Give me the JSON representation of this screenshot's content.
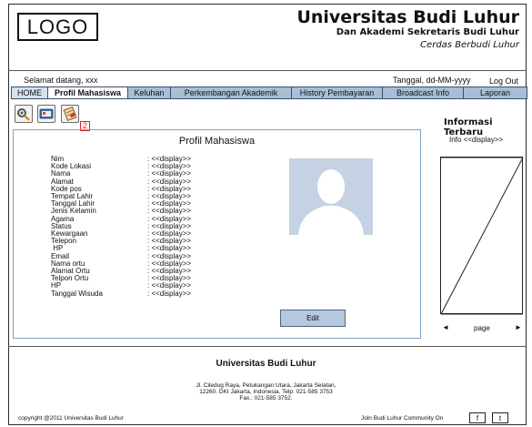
{
  "header": {
    "logo_text": "LOGO",
    "title": "Universitas Budi Luhur",
    "subtitle": "Dan Akademi Sekretaris Budi Luhur",
    "tagline": "Cerdas Berbudi Luhur"
  },
  "userbar": {
    "welcome": "Selamat datang, xxx",
    "date": "Tanggal, dd-MM-yyyy",
    "logout": "Log Out"
  },
  "nav": {
    "items": [
      {
        "label": "HOME"
      },
      {
        "label": "Profil Mahasiswa"
      },
      {
        "label": "Keluhan"
      },
      {
        "label": "Perkembangan Akademik"
      },
      {
        "label": "History Pembayaran"
      },
      {
        "label": "Broadcast Info"
      },
      {
        "label": "Laporan"
      }
    ]
  },
  "toolbar": {
    "icons": [
      "settings-icon",
      "card-icon",
      "notes-icon"
    ],
    "badge": "2"
  },
  "profile": {
    "title": "Profil Mahasiswa",
    "fields": [
      {
        "label": "Nim",
        "value": ": <<display>>"
      },
      {
        "label": "Kode Lokasi",
        "value": ": <<display>>"
      },
      {
        "label": "Nama",
        "value": ": <<display>>"
      },
      {
        "label": "Alamat",
        "value": ": <<display>>"
      },
      {
        "label": "Kode pos",
        "value": ": <<display>>"
      },
      {
        "label": "Tempat Lahir",
        "value": ": <<display>>"
      },
      {
        "label": "Tanggal Lahir",
        "value": ": <<display>>"
      },
      {
        "label": "Jenis Kelamin",
        "value": ": <<display>>"
      },
      {
        "label": "Agama",
        "value": ": <<display>>"
      },
      {
        "label": "Status",
        "value": ": <<display>>"
      },
      {
        "label": "Kewargaan",
        "value": ": <<display>>"
      },
      {
        "label": "Telepon",
        "value": ": <<display>>"
      },
      {
        "label": " HP",
        "value": ": <<display>>"
      },
      {
        "label": "Email",
        "value": ": <<display>>"
      },
      {
        "label": "Nama ortu",
        "value": ": <<display>>"
      },
      {
        "label": "Alamat Ortu",
        "value": ": <<display>>"
      },
      {
        "label": "Telpon Ortu",
        "value": ": <<display>>"
      },
      {
        "label": "HP",
        "value": ": <<display>>"
      },
      {
        "label": "Tanggal Wisuda",
        "value": ": <<display>>"
      }
    ],
    "edit_label": "Edit"
  },
  "sidebar": {
    "title": "Informasi Terbaru",
    "display": "Info <<display>>",
    "page_label": "page",
    "prev_icon": "arrow-left-icon",
    "next_icon": "arrow-right-icon"
  },
  "footer": {
    "title": "Universitas Budi Luhur",
    "address": [
      "Jl. Ciledug Raya, Petukangan Utara, Jakarta Selatan,",
      "12260. DKI Jakarta, Indonesia. Telp: 021-585 3753",
      "Fax.: 021-585 3752."
    ],
    "copyright": "copyright @2011 Universitas Budi Luhur",
    "join": "Join Budi Luhur Community On",
    "facebook": "f",
    "twitter": "t"
  },
  "colors": {
    "nav_bg": "#a7bed6",
    "panel_border": "#7fa3c6",
    "button_bg": "#b6c8de",
    "badge": "#dd2222"
  }
}
